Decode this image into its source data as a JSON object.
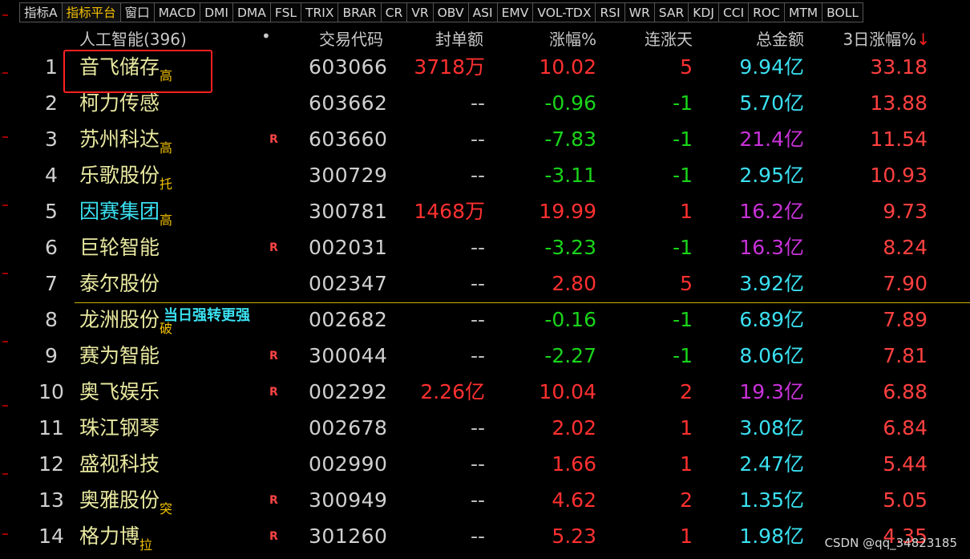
{
  "tabs": [
    {
      "label": "指标A",
      "active": false
    },
    {
      "label": "指标平台",
      "active": true
    },
    {
      "label": "窗口",
      "active": false
    },
    {
      "label": "MACD",
      "active": false
    },
    {
      "label": "DMI",
      "active": false
    },
    {
      "label": "DMA",
      "active": false
    },
    {
      "label": "FSL",
      "active": false
    },
    {
      "label": "TRIX",
      "active": false
    },
    {
      "label": "BRAR",
      "active": false
    },
    {
      "label": "CR",
      "active": false
    },
    {
      "label": "VR",
      "active": false
    },
    {
      "label": "OBV",
      "active": false
    },
    {
      "label": "ASI",
      "active": false
    },
    {
      "label": "EMV",
      "active": false
    },
    {
      "label": "VOL-TDX",
      "active": false
    },
    {
      "label": "RSI",
      "active": false
    },
    {
      "label": "WR",
      "active": false
    },
    {
      "label": "SAR",
      "active": false
    },
    {
      "label": "KDJ",
      "active": false
    },
    {
      "label": "CCI",
      "active": false
    },
    {
      "label": "ROC",
      "active": false
    },
    {
      "label": "MTM",
      "active": false
    },
    {
      "label": "BOLL",
      "active": false
    }
  ],
  "header": {
    "group": "人工智能(396)",
    "dot": "•",
    "code": "交易代码",
    "seal": "封单额",
    "change": "涨幅%",
    "days": "连涨天",
    "amount": "总金额",
    "pct3": "3日涨幅%",
    "sort_arrow": "↓"
  },
  "rows": [
    {
      "idx": "1",
      "name": "音飞储存",
      "tag": "高",
      "r": "",
      "code": "603066",
      "seal": "3718万",
      "change": "10.02",
      "days": "5",
      "amount": "9.94亿",
      "pct3": "33.18",
      "seal_color": "red",
      "change_color": "red",
      "days_color": "red",
      "amount_color": "cyan",
      "name_color": "yellow"
    },
    {
      "idx": "2",
      "name": "柯力传感",
      "tag": "",
      "r": "",
      "code": "603662",
      "seal": "--",
      "change": "-0.96",
      "days": "-1",
      "amount": "5.70亿",
      "pct3": "13.88",
      "seal_color": "grey",
      "change_color": "green",
      "days_color": "green",
      "amount_color": "cyan",
      "name_color": "yellow"
    },
    {
      "idx": "3",
      "name": "苏州科达",
      "tag": "高",
      "r": "R",
      "code": "603660",
      "seal": "--",
      "change": "-7.83",
      "days": "-1",
      "amount": "21.4亿",
      "pct3": "11.54",
      "seal_color": "grey",
      "change_color": "green",
      "days_color": "green",
      "amount_color": "magenta",
      "name_color": "yellow"
    },
    {
      "idx": "4",
      "name": "乐歌股份",
      "tag": "托",
      "r": "",
      "code": "300729",
      "seal": "--",
      "change": "-3.11",
      "days": "-1",
      "amount": "2.95亿",
      "pct3": "10.93",
      "seal_color": "grey",
      "change_color": "green",
      "days_color": "green",
      "amount_color": "cyan",
      "name_color": "yellow"
    },
    {
      "idx": "5",
      "name": "因赛集团",
      "tag": "高",
      "r": "",
      "code": "300781",
      "seal": "1468万",
      "change": "19.99",
      "days": "1",
      "amount": "16.2亿",
      "pct3": "9.73",
      "seal_color": "red",
      "change_color": "red",
      "days_color": "red",
      "amount_color": "magenta",
      "name_color": "cyan"
    },
    {
      "idx": "6",
      "name": "巨轮智能",
      "tag": "",
      "r": "R",
      "code": "002031",
      "seal": "--",
      "change": "-3.23",
      "days": "-1",
      "amount": "16.3亿",
      "pct3": "8.24",
      "seal_color": "grey",
      "change_color": "green",
      "days_color": "green",
      "amount_color": "magenta",
      "name_color": "yellow"
    },
    {
      "idx": "7",
      "name": "泰尔股份",
      "tag": "",
      "r": "",
      "code": "002347",
      "seal": "--",
      "change": "2.80",
      "days": "5",
      "amount": "3.92亿",
      "pct3": "7.90",
      "seal_color": "grey",
      "change_color": "red",
      "days_color": "red",
      "amount_color": "cyan",
      "name_color": "yellow"
    },
    {
      "idx": "8",
      "name": "龙洲股份",
      "tag": "破",
      "r": "",
      "code": "002682",
      "seal": "--",
      "change": "-0.16",
      "days": "-1",
      "amount": "6.89亿",
      "pct3": "7.89",
      "seal_color": "grey",
      "change_color": "green",
      "days_color": "green",
      "amount_color": "cyan",
      "name_color": "yellow"
    },
    {
      "idx": "9",
      "name": "赛为智能",
      "tag": "",
      "r": "R",
      "code": "300044",
      "seal": "--",
      "change": "-2.27",
      "days": "-1",
      "amount": "8.06亿",
      "pct3": "7.81",
      "seal_color": "grey",
      "change_color": "green",
      "days_color": "green",
      "amount_color": "cyan",
      "name_color": "yellow"
    },
    {
      "idx": "10",
      "name": "奥飞娱乐",
      "tag": "",
      "r": "R",
      "code": "002292",
      "seal": "2.26亿",
      "change": "10.04",
      "days": "2",
      "amount": "19.3亿",
      "pct3": "6.88",
      "seal_color": "red",
      "change_color": "red",
      "days_color": "red",
      "amount_color": "magenta",
      "name_color": "yellow"
    },
    {
      "idx": "11",
      "name": "珠江钢琴",
      "tag": "",
      "r": "",
      "code": "002678",
      "seal": "--",
      "change": "2.02",
      "days": "1",
      "amount": "3.08亿",
      "pct3": "6.84",
      "seal_color": "grey",
      "change_color": "red",
      "days_color": "red",
      "amount_color": "cyan",
      "name_color": "yellow"
    },
    {
      "idx": "12",
      "name": "盛视科技",
      "tag": "",
      "r": "",
      "code": "002990",
      "seal": "--",
      "change": "1.66",
      "days": "1",
      "amount": "2.47亿",
      "pct3": "5.44",
      "seal_color": "grey",
      "change_color": "red",
      "days_color": "red",
      "amount_color": "cyan",
      "name_color": "yellow"
    },
    {
      "idx": "13",
      "name": "奥雅股份",
      "tag": "突",
      "r": "R",
      "code": "300949",
      "seal": "--",
      "change": "4.62",
      "days": "2",
      "amount": "1.35亿",
      "pct3": "5.05",
      "seal_color": "grey",
      "change_color": "red",
      "days_color": "red",
      "amount_color": "cyan",
      "name_color": "yellow"
    },
    {
      "idx": "14",
      "name": "格力博",
      "tag": "拉",
      "r": "R",
      "code": "301260",
      "seal": "--",
      "change": "5.23",
      "days": "1",
      "amount": "1.98亿",
      "pct3": "4.35",
      "seal_color": "grey",
      "change_color": "red",
      "days_color": "red",
      "amount_color": "cyan",
      "name_color": "yellow"
    }
  ],
  "annotation": "当日强转更强",
  "watermark": "CSDN @qq_34823185",
  "colors": {
    "red": "#ff3030",
    "green": "#1ad41a",
    "cyan": "#3ae0f0",
    "magenta": "#c832d8",
    "yellow": "#e8e8a0",
    "grey": "#bdbdbd",
    "active_tab": "#f6c000",
    "highlight_box": "#ff2020"
  }
}
